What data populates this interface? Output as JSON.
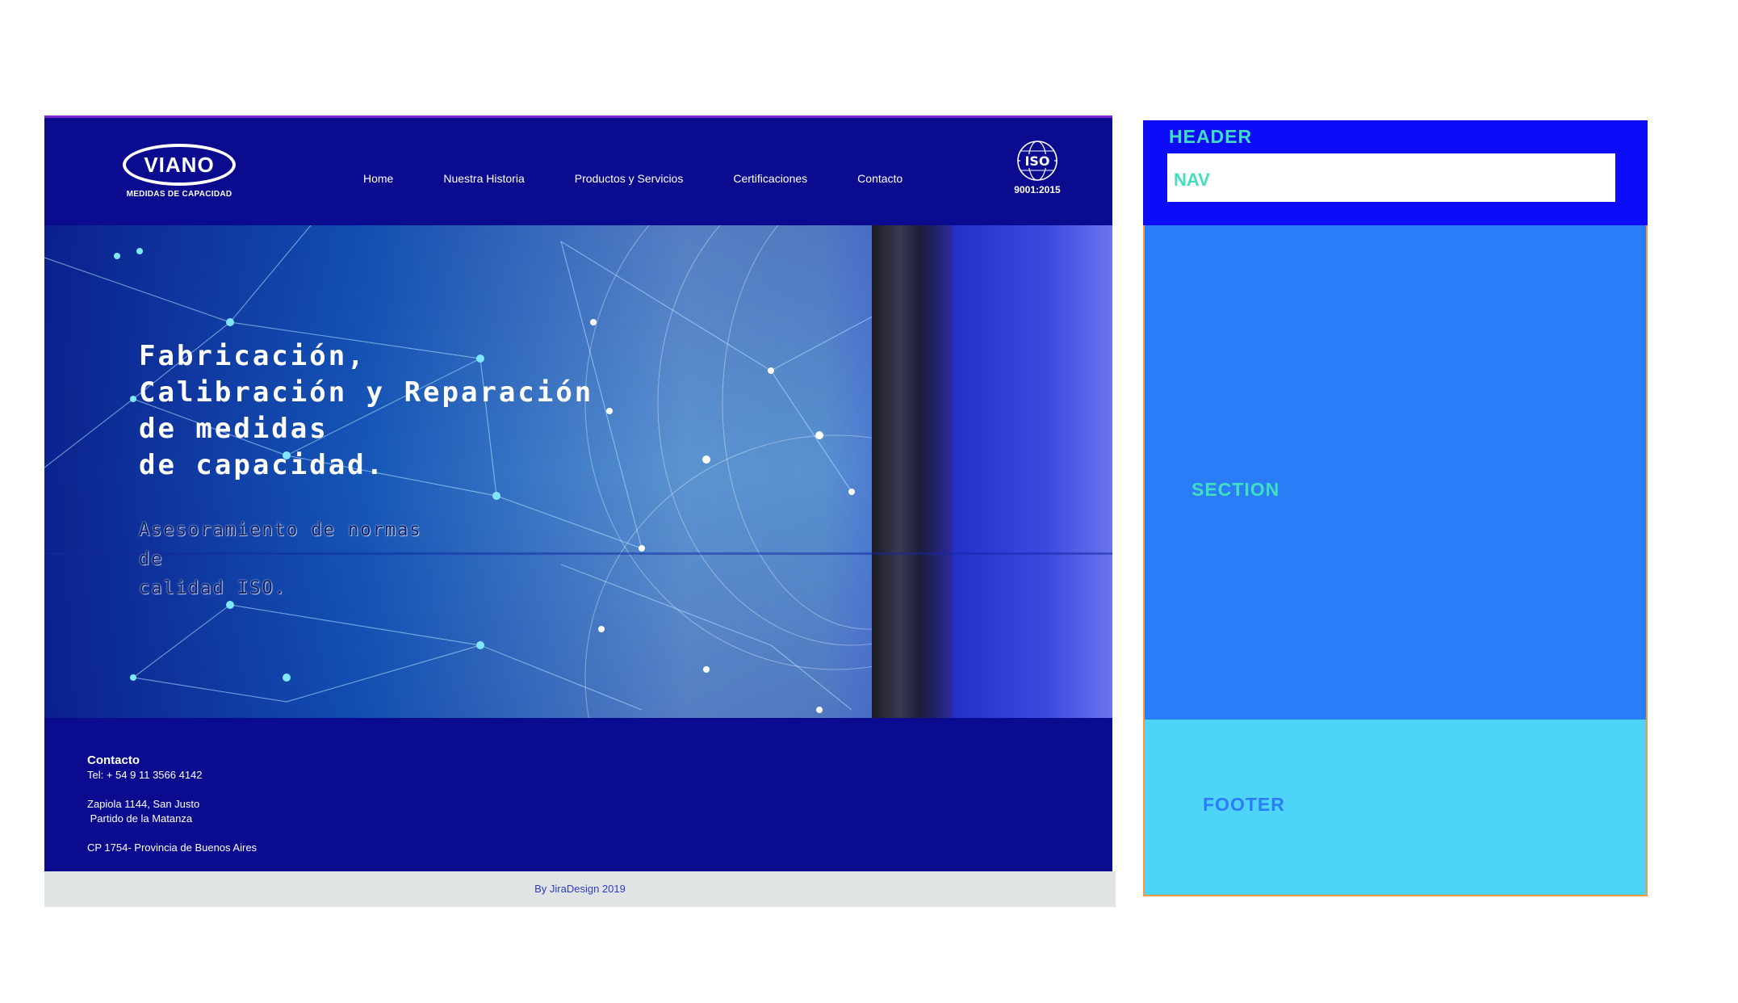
{
  "mockup": {
    "logo": {
      "name": "VIANO",
      "tagline": "MEDIDAS DE CAPACIDAD"
    },
    "nav": [
      {
        "label": "Home"
      },
      {
        "label": "Nuestra Historia"
      },
      {
        "label": "Productos y Servicios"
      },
      {
        "label": "Certificaciones"
      },
      {
        "label": "Contacto"
      }
    ],
    "iso": {
      "label": "ISO",
      "standard": "9001:2015"
    },
    "hero": {
      "title_lines": [
        "Fabricación,",
        "Calibración y Reparación",
        "de medidas",
        "de capacidad."
      ],
      "subtitle_lines": [
        "Asesoramiento de normas de",
        "calidad ISO."
      ]
    },
    "footer": {
      "title": "Contacto",
      "phone": "Tel: + 54 9 11 3566 4142",
      "address_line1": "Zapiola 1144, San Justo",
      "address_line2": " Partido de la Matanza",
      "address_line3": "CP 1754- Provincia de Buenos Aires"
    },
    "credit": "By JiraDesign 2019"
  },
  "wireframe": {
    "header_label": "HEADER",
    "nav_label": "NAV",
    "section_label": "SECTION",
    "footer_label": "FOOTER"
  },
  "colors": {
    "site_blue": "#0a0b8e",
    "wire_header": "#0c0cfa",
    "wire_section": "#2a7cf7",
    "wire_footer": "#4dd4f8",
    "wire_label": "#3fe0c0",
    "wire_border": "#f39a3a"
  }
}
